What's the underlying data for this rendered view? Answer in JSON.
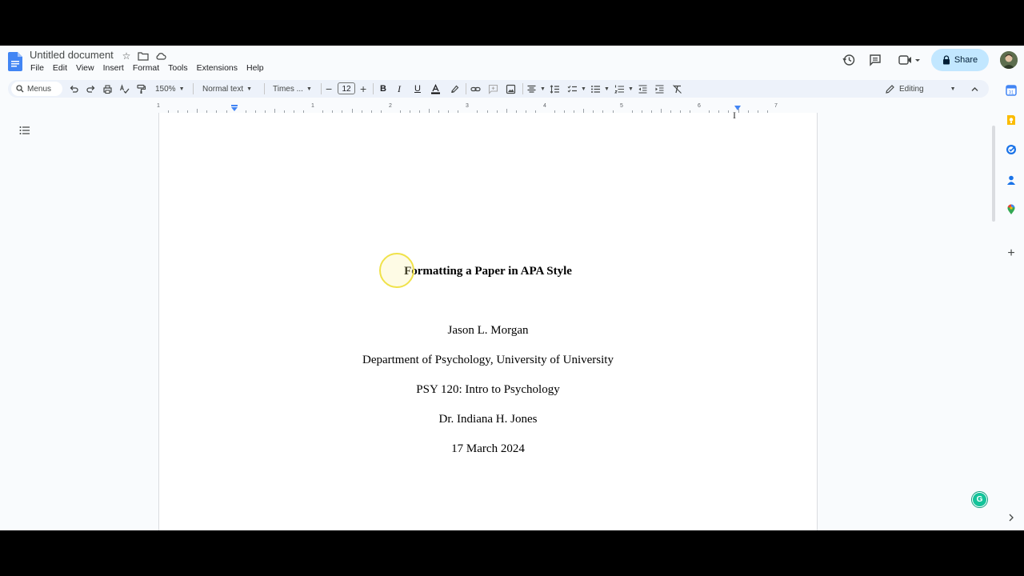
{
  "header": {
    "doc_title": "Untitled document",
    "menus": [
      "File",
      "Edit",
      "View",
      "Insert",
      "Format",
      "Tools",
      "Extensions",
      "Help"
    ],
    "share_label": "Share"
  },
  "toolbar": {
    "search_label": "Menus",
    "zoom": "150%",
    "style": "Normal text",
    "font": "Times ...",
    "font_size": "12",
    "mode": "Editing"
  },
  "ruler": {
    "numbers": [
      "1",
      "1",
      "2",
      "3",
      "4",
      "5",
      "6",
      "7"
    ]
  },
  "document": {
    "heading": "Formatting a Paper in APA Style",
    "lines": [
      "Jason L. Morgan",
      "Department of Psychology, University of University",
      "PSY 120: Intro to Psychology",
      "Dr. Indiana H. Jones",
      "17 March 2024"
    ]
  },
  "colors": {
    "accent": "#c2e7ff",
    "docs_blue": "#4285f4",
    "grammarly": "#15c39a"
  }
}
